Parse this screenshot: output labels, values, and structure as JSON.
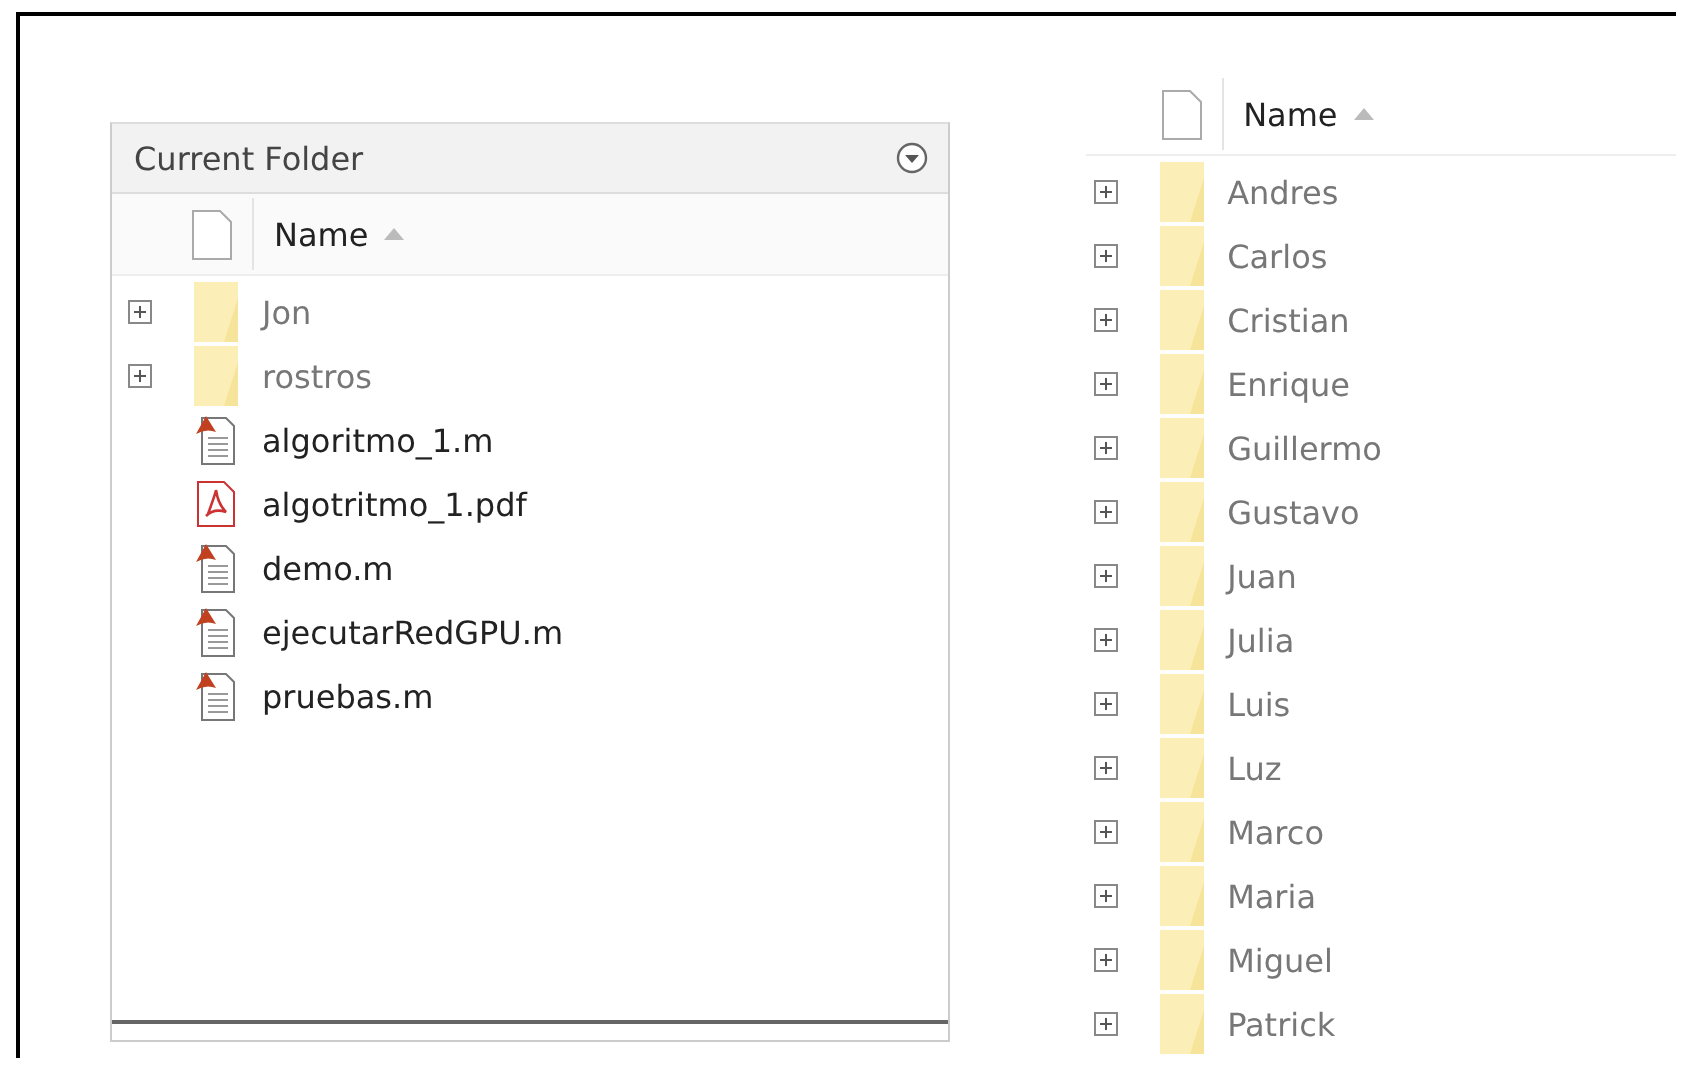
{
  "left_panel": {
    "title": "Current Folder",
    "header": {
      "name_column": "Name"
    },
    "items": [
      {
        "kind": "folder",
        "name": "Jon",
        "expanded": false
      },
      {
        "kind": "folder",
        "name": "rostros",
        "expanded": false
      },
      {
        "kind": "mfile",
        "name": "algoritmo_1.m"
      },
      {
        "kind": "pdf",
        "name": "algotritmo_1.pdf"
      },
      {
        "kind": "mfile",
        "name": "demo.m"
      },
      {
        "kind": "mfile",
        "name": "ejecutarRedGPU.m"
      },
      {
        "kind": "mfile",
        "name": "pruebas.m"
      }
    ]
  },
  "right_panel": {
    "header": {
      "name_column": "Name"
    },
    "items": [
      {
        "kind": "folder",
        "name": "Andres",
        "expanded": false
      },
      {
        "kind": "folder",
        "name": "Carlos",
        "expanded": false
      },
      {
        "kind": "folder",
        "name": "Cristian",
        "expanded": false
      },
      {
        "kind": "folder",
        "name": "Enrique",
        "expanded": false
      },
      {
        "kind": "folder",
        "name": "Guillermo",
        "expanded": false
      },
      {
        "kind": "folder",
        "name": "Gustavo",
        "expanded": false
      },
      {
        "kind": "folder",
        "name": "Juan",
        "expanded": false
      },
      {
        "kind": "folder",
        "name": "Julia",
        "expanded": false
      },
      {
        "kind": "folder",
        "name": "Luis",
        "expanded": false
      },
      {
        "kind": "folder",
        "name": "Luz",
        "expanded": false
      },
      {
        "kind": "folder",
        "name": "Marco",
        "expanded": false
      },
      {
        "kind": "folder",
        "name": "Maria",
        "expanded": false
      },
      {
        "kind": "folder",
        "name": "Miguel",
        "expanded": false
      },
      {
        "kind": "folder",
        "name": "Patrick",
        "expanded": false
      }
    ]
  }
}
